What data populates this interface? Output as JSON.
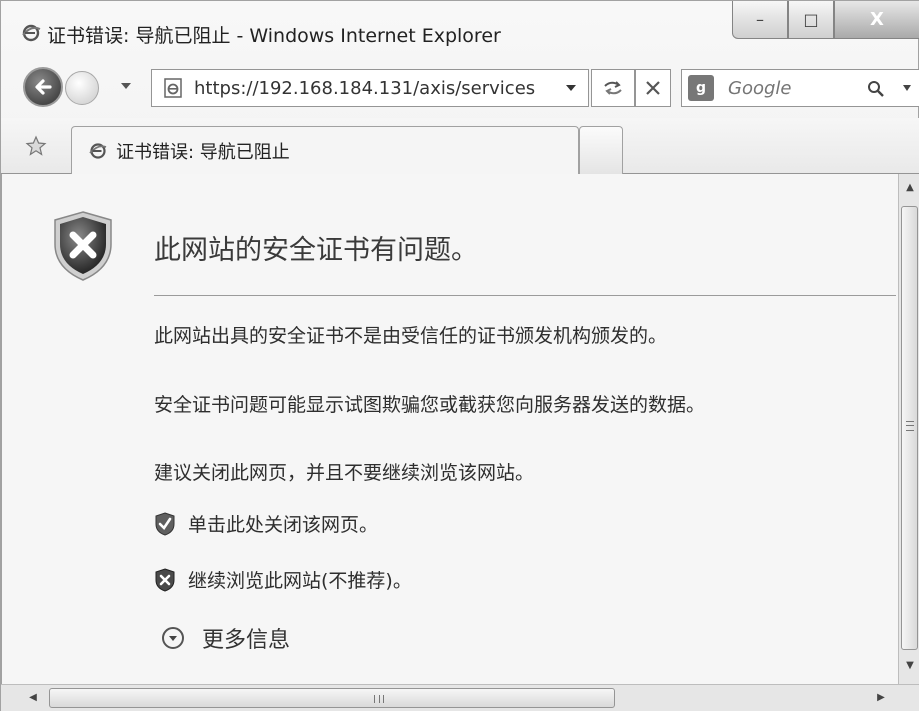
{
  "window": {
    "title": "证书错误: 导航已阻止 - Windows Internet Explorer",
    "controls": {
      "minimize": "–",
      "maximize": "□",
      "close": "X"
    }
  },
  "navigation": {
    "address": "https://192.168.184.131/axis/services",
    "search_placeholder": "Google"
  },
  "tabs": [
    {
      "label": "证书错误: 导航已阻止"
    }
  ],
  "page": {
    "headline": "此网站的安全证书有问题。",
    "paragraphs": [
      "此网站出具的安全证书不是由受信任的证书颁发机构颁发的。",
      "安全证书问题可能显示试图欺骗您或截获您向服务器发送的数据。",
      "建议关闭此网页，并且不要继续浏览该网站。"
    ],
    "links": [
      {
        "label": "单击此处关闭该网页。",
        "icon": "green-shield-check-icon"
      },
      {
        "label": "继续浏览此网站(不推荐)。",
        "icon": "red-shield-x-icon"
      }
    ],
    "more_info": "更多信息"
  },
  "scrollbar": {
    "vertical_up": "▲",
    "vertical_down": "▼",
    "horizontal_left": "◀",
    "horizontal_right": "▶"
  }
}
